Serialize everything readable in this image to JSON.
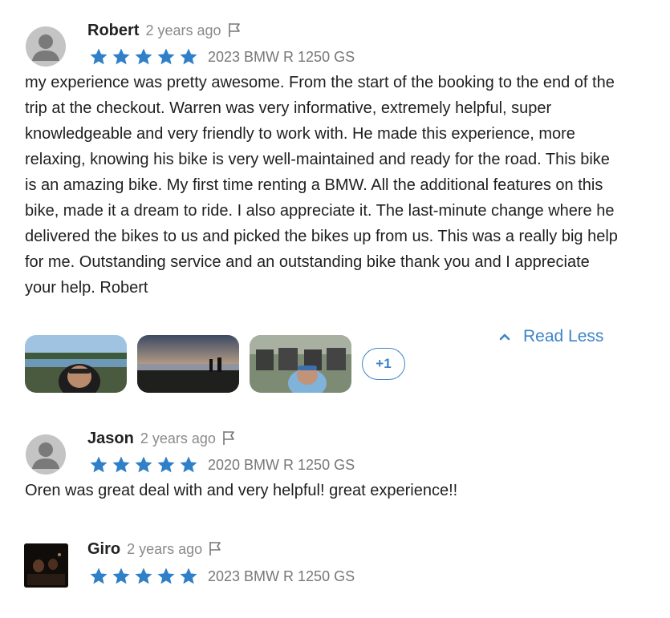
{
  "reviews": [
    {
      "name": "Robert",
      "time_ago": "2 years ago",
      "rating": 5,
      "bike": "2023 BMW R 1250 GS",
      "text": "my experience was pretty awesome. From the start of the booking to the end of the trip at the checkout. Warren was very informative, extremely helpful, super knowledgeable and very friendly to work with. He made this experience, more relaxing, knowing his bike is very well-maintained and ready for the road. This bike is an amazing bike. My first time renting a BMW. All the additional features on this bike, made it a dream to ride. I also appreciate it. The last-minute change where he delivered the bikes to us and picked the bikes up from us. This was a really big help for me. Outstanding service and an outstanding bike thank you and I appreciate your help. Robert",
      "more_photos_label": "+1",
      "read_less_label": "Read Less"
    },
    {
      "name": "Jason",
      "time_ago": "2 years ago",
      "rating": 5,
      "bike": "2020 BMW R 1250 GS",
      "text": "Oren was great deal with and very helpful! great experience!!"
    },
    {
      "name": "Giro",
      "time_ago": "2 years ago",
      "rating": 5,
      "bike": "2023 BMW R 1250 GS"
    }
  ],
  "colors": {
    "star": "#2f7fc9",
    "link": "#3d84c8",
    "meta": "#8a8a8a"
  }
}
